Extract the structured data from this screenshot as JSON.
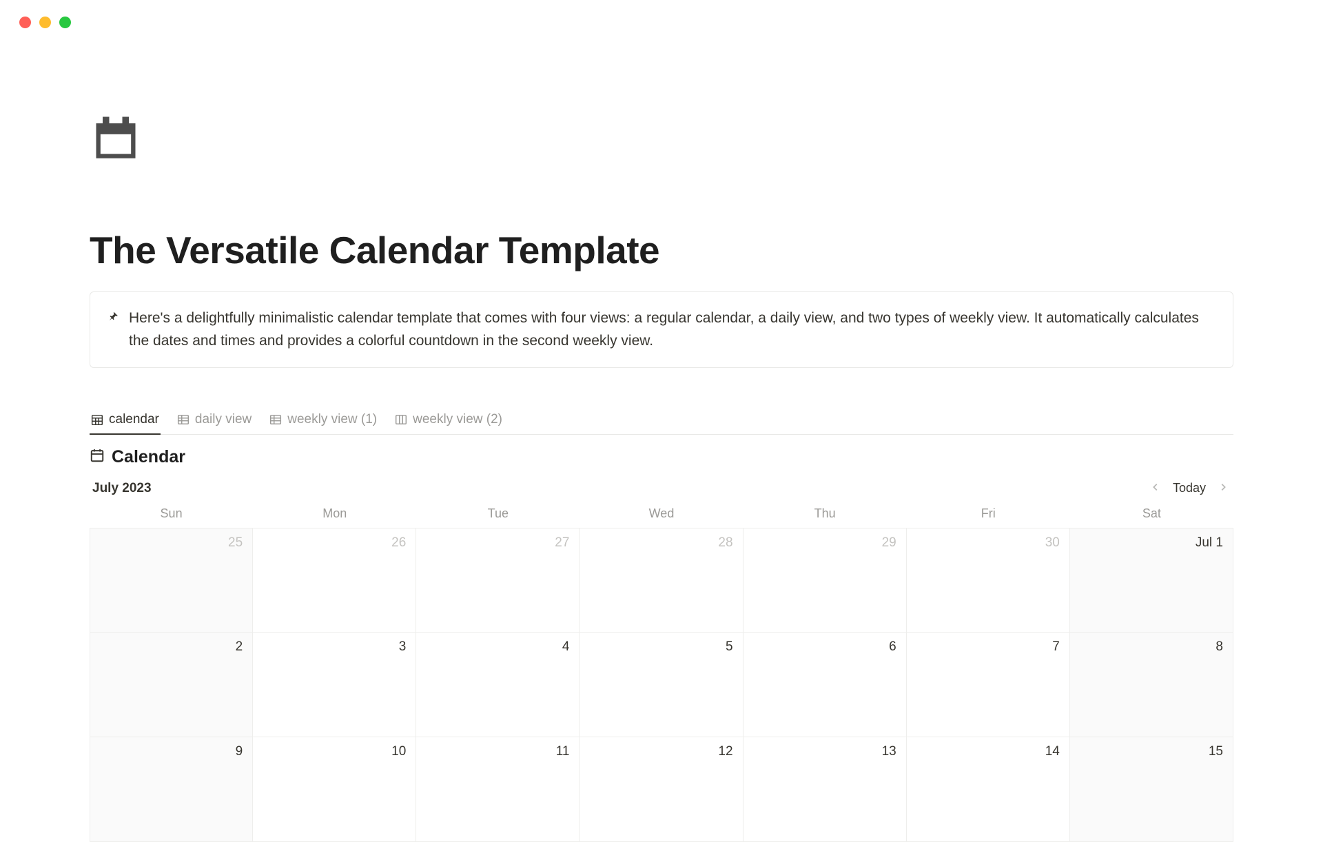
{
  "page": {
    "title": "The Versatile Calendar Template",
    "callout": "Here's a delightfully minimalistic calendar template that comes with four views: a regular calendar, a daily view, and two types of weekly view.  It automatically calculates the dates and times and provides a colorful countdown in the second weekly view."
  },
  "tabs": [
    {
      "label": "calendar"
    },
    {
      "label": "daily view"
    },
    {
      "label": "weekly view (1)"
    },
    {
      "label": "weekly view (2)"
    }
  ],
  "section": {
    "title": "Calendar"
  },
  "calendar": {
    "month_label": "July 2023",
    "today_label": "Today",
    "day_headers": [
      "Sun",
      "Mon",
      "Tue",
      "Wed",
      "Thu",
      "Fri",
      "Sat"
    ],
    "rows": [
      [
        {
          "label": "25",
          "other": true
        },
        {
          "label": "26",
          "other": true
        },
        {
          "label": "27",
          "other": true
        },
        {
          "label": "28",
          "other": true
        },
        {
          "label": "29",
          "other": true
        },
        {
          "label": "30",
          "other": true
        },
        {
          "label": "Jul 1",
          "other": false
        }
      ],
      [
        {
          "label": "2"
        },
        {
          "label": "3"
        },
        {
          "label": "4"
        },
        {
          "label": "5"
        },
        {
          "label": "6"
        },
        {
          "label": "7"
        },
        {
          "label": "8"
        }
      ],
      [
        {
          "label": "9"
        },
        {
          "label": "10"
        },
        {
          "label": "11"
        },
        {
          "label": "12"
        },
        {
          "label": "13"
        },
        {
          "label": "14"
        },
        {
          "label": "15"
        }
      ]
    ]
  }
}
